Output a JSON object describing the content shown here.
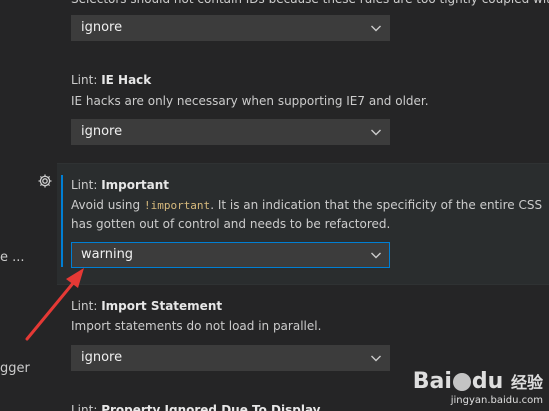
{
  "sidebar": {
    "truncated_item_1": "e ...",
    "truncated_item_2": "gger"
  },
  "settings": [
    {
      "description": "Selectors should not contain IDs because these rules are too tightly coupled with the",
      "value": "ignore"
    },
    {
      "category": "Lint: ",
      "name": "IE Hack",
      "description": "IE hacks are only necessary when supporting IE7 and older.",
      "value": "ignore"
    },
    {
      "category": "Lint: ",
      "name": "Important",
      "description_prefix": "Avoid using ",
      "description_code": "!important",
      "description_suffix": ". It is an indication that the specificity of the entire CSS has gotten out of control and needs to be refactored.",
      "value": "warning",
      "focused": true
    },
    {
      "category": "Lint: ",
      "name": "Import Statement",
      "description": "Import statements do not load in parallel.",
      "value": "ignore"
    },
    {
      "category": "Lint: ",
      "name": "Property Ignored Due To Display"
    }
  ],
  "watermark": {
    "logo_text_1": "Bai",
    "logo_text_2": "du",
    "logo_text_3": "经验",
    "url": "jingyan.baidu.com"
  },
  "colors": {
    "background": "#252526",
    "focus_border": "#007fd4",
    "select_bg": "#3c3c3c",
    "code_text": "#d7ba7d",
    "annotation_arrow": "#e53935"
  },
  "icons": {
    "gear": "gear-icon",
    "dropdown": "chevron-down-icon"
  }
}
